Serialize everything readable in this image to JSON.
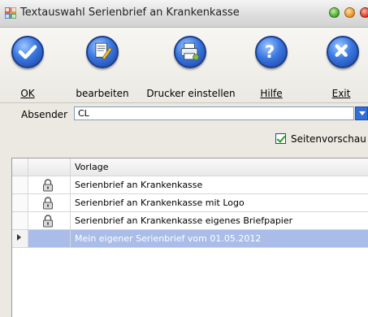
{
  "window": {
    "title": "Textauswahl Serienbrief an Krankenkasse"
  },
  "toolbar": {
    "buttons": [
      {
        "id": "ok",
        "label": "OK",
        "icon": "check-icon"
      },
      {
        "id": "edit",
        "label": "bearbeiten",
        "icon": "edit-document-icon"
      },
      {
        "id": "printer",
        "label": "Drucker einstellen",
        "icon": "printer-icon"
      },
      {
        "id": "help",
        "label": "Hilfe",
        "icon": "help-icon"
      },
      {
        "id": "exit",
        "label": "Exit",
        "icon": "close-icon"
      }
    ]
  },
  "sender": {
    "label": "Absender",
    "value": "CL"
  },
  "preview": {
    "label": "Seitenvorschau",
    "checked": true
  },
  "table": {
    "column": "Vorlage",
    "rows": [
      {
        "name": "Serienbrief an Krankenkasse",
        "locked": true,
        "selected": false
      },
      {
        "name": "Serienbrief an Krankenkasse mit Logo",
        "locked": true,
        "selected": false
      },
      {
        "name": "Serienbrief an Krankenkasse eigenes Briefpapier",
        "locked": true,
        "selected": false
      },
      {
        "name": "Mein eigener Serienbrief vom 01.05.2012",
        "locked": false,
        "selected": true
      }
    ]
  },
  "colors": {
    "accent": "#2f6fd6",
    "selection": "#a9bde8"
  }
}
